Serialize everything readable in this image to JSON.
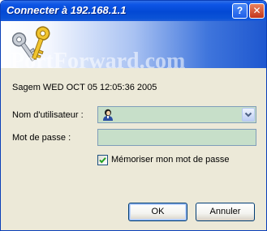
{
  "window": {
    "title": "Connecter à 192.168.1.1",
    "help_glyph": "?",
    "close_glyph": "✕"
  },
  "banner": {
    "watermark": "PortForward.com"
  },
  "dialog": {
    "info": "Sagem WED OCT 05 12:05:36 2005",
    "username_label": "Nom d'utilisateur :",
    "username_value": "",
    "password_label": "Mot de passe :",
    "password_value": "",
    "remember_label": "Mémoriser mon mot de passe",
    "remember_checked": true
  },
  "buttons": {
    "ok": "OK",
    "cancel": "Annuler"
  },
  "colors": {
    "titlebar": "#0349d4",
    "field_bg": "#c7dfc9",
    "dialog_bg": "#ece9d8"
  }
}
